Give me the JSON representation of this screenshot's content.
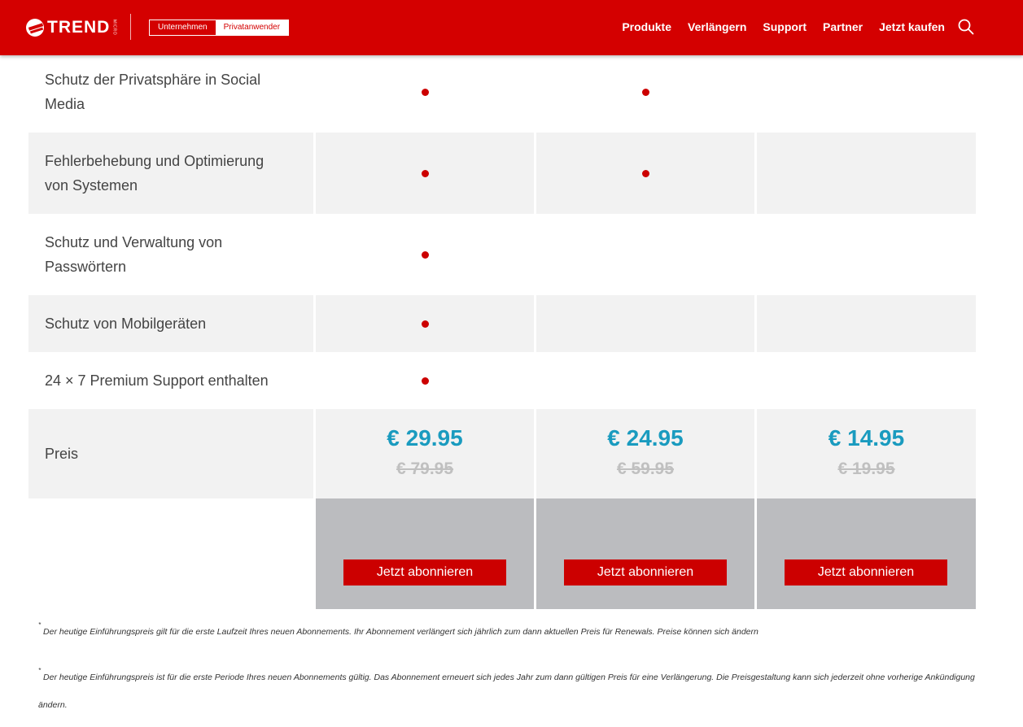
{
  "header": {
    "logo_text": "TREND",
    "logo_micro": "MICRO",
    "segments": {
      "business": "Unternehmen",
      "private": "Privatanwender"
    },
    "nav": [
      "Produkte",
      "Verlängern",
      "Support",
      "Partner",
      "Jetzt kaufen"
    ],
    "search_icon": "search-icon",
    "brand_color": "#d40000"
  },
  "table": {
    "features": [
      {
        "label": "Schutz der Privatsphäre in Social Media",
        "included": [
          true,
          true,
          false
        ]
      },
      {
        "label": "Fehlerbehebung und Optimierung von Systemen",
        "included": [
          true,
          true,
          false
        ]
      },
      {
        "label": "Schutz und Verwaltung von Passwörtern",
        "included": [
          true,
          false,
          false
        ]
      },
      {
        "label": "Schutz von Mobilgeräten",
        "included": [
          true,
          false,
          false
        ]
      },
      {
        "label": "24 × 7 Premium Support enthalten",
        "included": [
          true,
          false,
          false
        ]
      }
    ],
    "price_label": "Preis",
    "prices": [
      {
        "new": "€ 29.95",
        "old": "€ 79.95"
      },
      {
        "new": "€ 24.95",
        "old": "€ 59.95"
      },
      {
        "new": "€ 14.95",
        "old": "€ 19.95"
      }
    ],
    "button_label": "Jetzt abonnieren",
    "price_color": "#1a9bbf",
    "dot_color": "#cc0000"
  },
  "notes": [
    {
      "mark": "*",
      "text": "Der heutige Einführungspreis gilt für die erste Laufzeit Ihres neuen Abonnements. Ihr Abonnement verlängert sich jährlich zum dann aktuellen Preis für Renewals. Preise können sich ändern"
    },
    {
      "mark": "*",
      "text": "Der heutige Einführungspreis ist für die erste Periode Ihres neuen Abonnements gültig. Das Abonnement erneuert sich jedes Jahr zum dann gültigen Preis für eine Verlängerung. Die Preisgestaltung kann sich jederzeit ohne vorherige Ankündigung ändern."
    }
  ]
}
